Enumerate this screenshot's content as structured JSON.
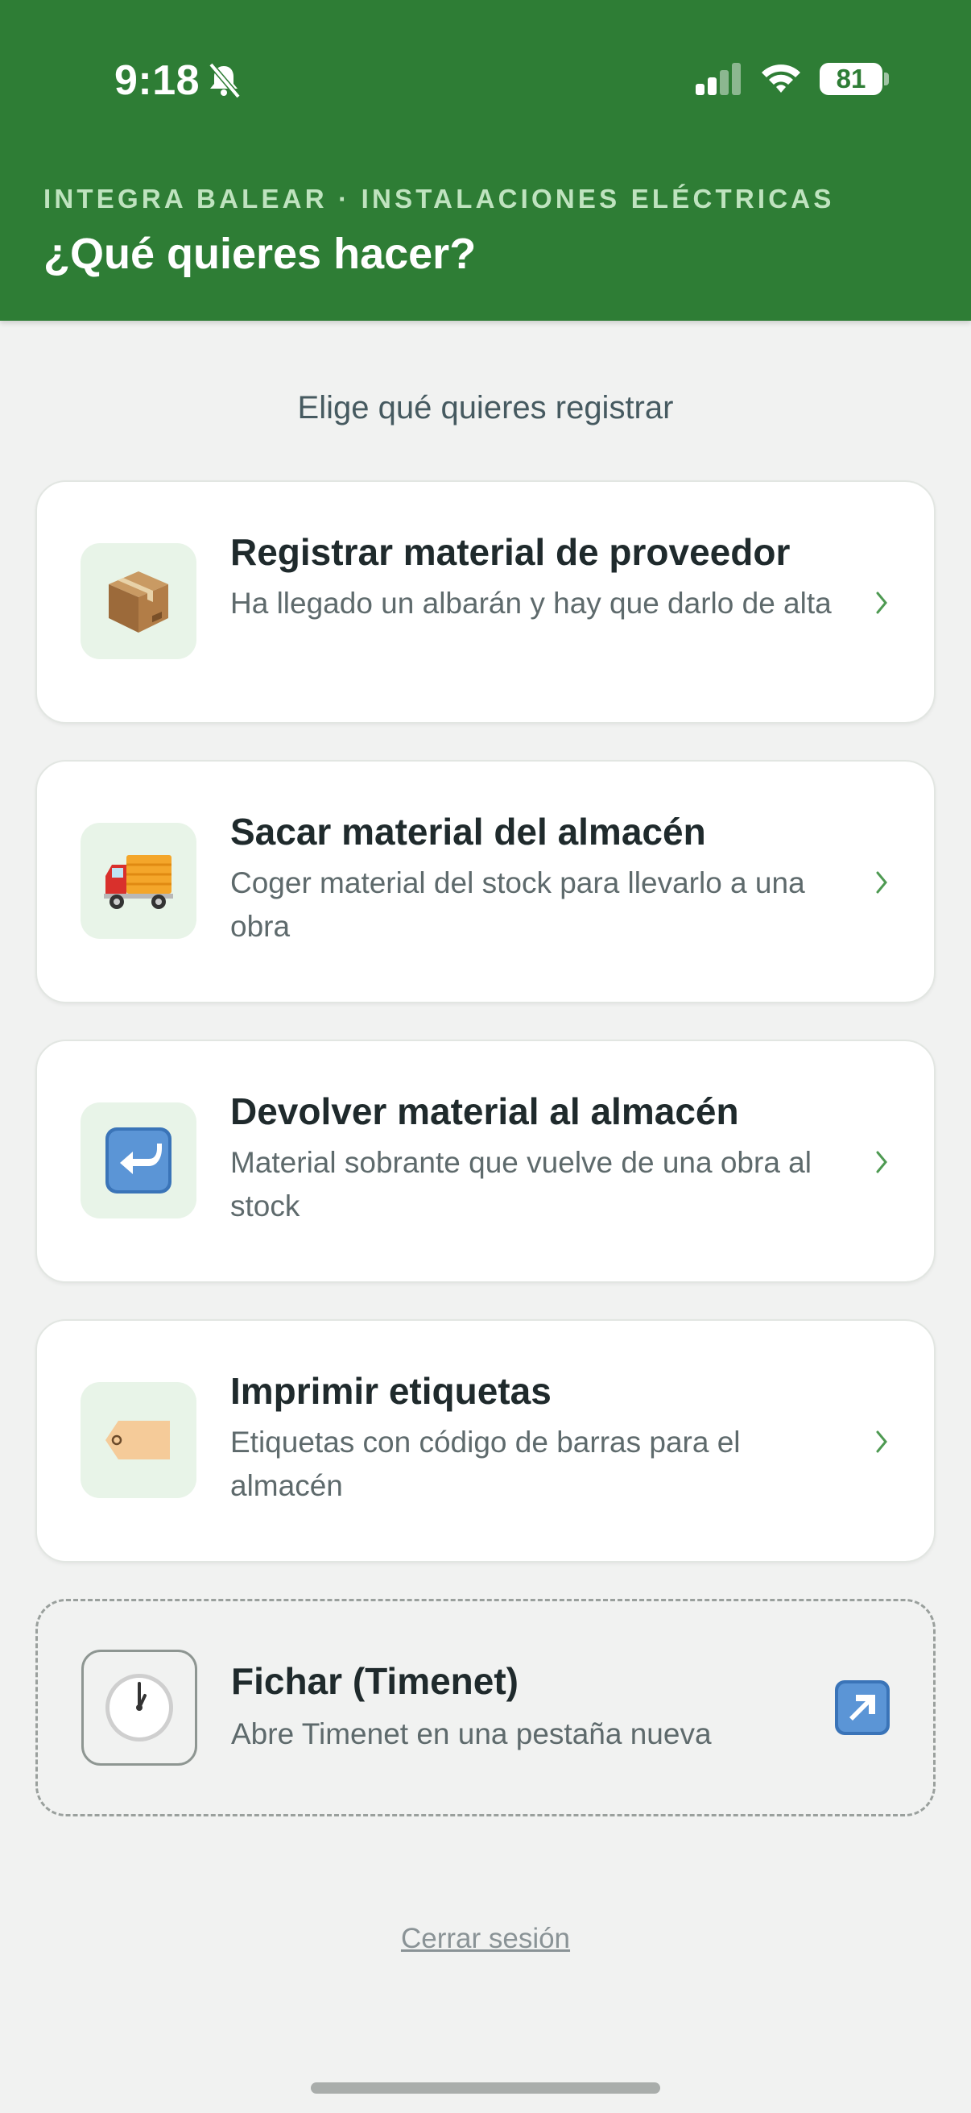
{
  "status_bar": {
    "time": "9:18",
    "battery": "81"
  },
  "header": {
    "company": "INTEGRA BALEAR · INSTALACIONES ELÉCTRICAS",
    "title": "¿Qué quieres hacer?"
  },
  "subtitle": "Elige qué quieres registrar",
  "actions": [
    {
      "title": "Registrar material de proveedor",
      "description": "Ha llegado un albarán y hay que darlo de alta",
      "icon": "package-icon"
    },
    {
      "title": "Sacar material del almacén",
      "description": "Coger material del stock para llevarlo a una obra",
      "icon": "truck-icon"
    },
    {
      "title": "Devolver material al almacén",
      "description": "Material sobrante que vuelve de una obra al stock",
      "icon": "return-arrow-icon"
    },
    {
      "title": "Imprimir etiquetas",
      "description": "Etiquetas con código de barras para el almacén",
      "icon": "label-tag-icon"
    }
  ],
  "timenet": {
    "title": "Fichar (Timenet)",
    "description": "Abre Timenet en una pestaña nueva",
    "icon": "clock-icon"
  },
  "logout": "Cerrar sesión",
  "colors": {
    "header": "#2e7d35",
    "accent_light": "#e8f4e8",
    "chevron": "#4e9a52"
  }
}
